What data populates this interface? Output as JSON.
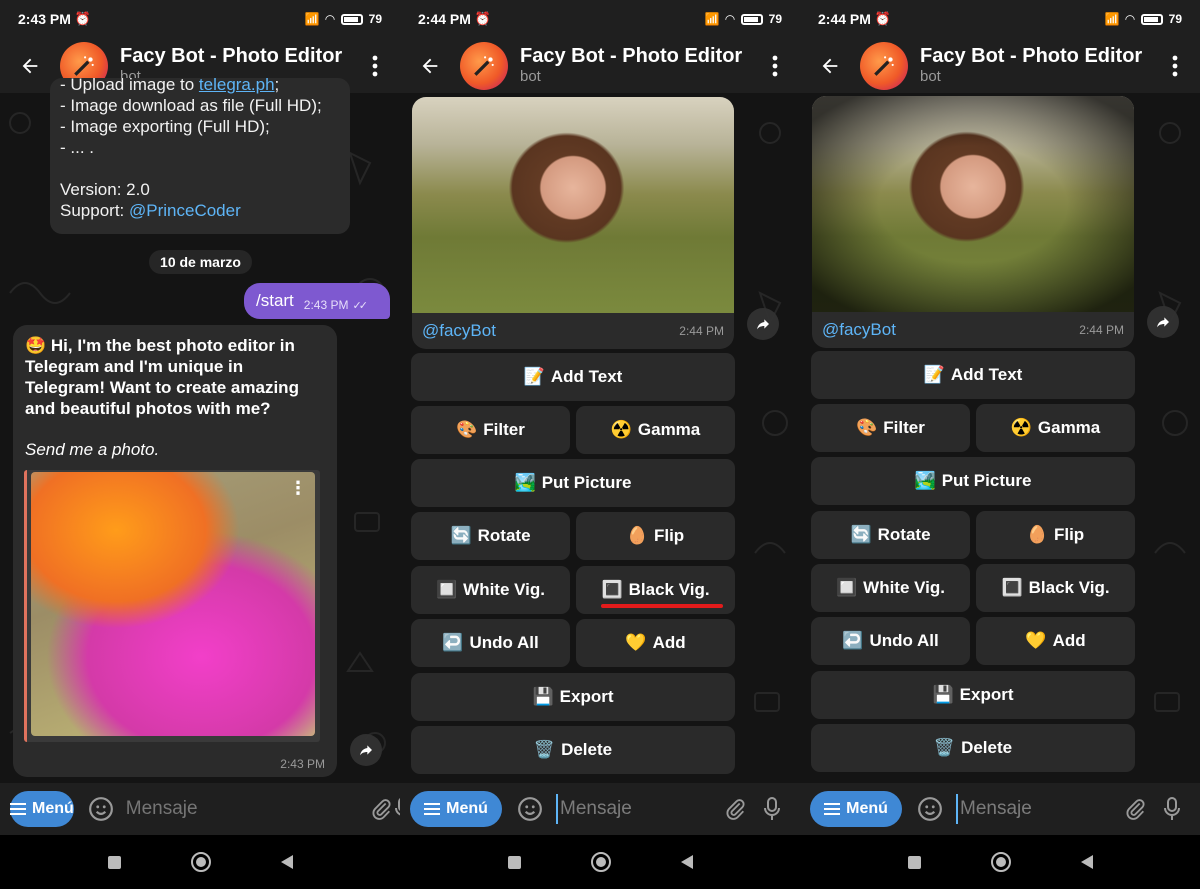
{
  "status_bar": [
    {
      "time": "2:43 PM",
      "battery": "79"
    },
    {
      "time": "2:44 PM",
      "battery": "79"
    },
    {
      "time": "2:44 PM",
      "battery": "79"
    }
  ],
  "chat": {
    "title": "Facy Bot - Photo Editor",
    "subtitle": "bot"
  },
  "screen1": {
    "info_lines": [
      "- Upload image to ",
      "- Image download as file (Full HD);",
      "- Image exporting (Full HD);",
      "- ... ."
    ],
    "info_link": "telegra.ph",
    "info_tail": ";",
    "version": "Version: 2.0",
    "support_label": "Support: ",
    "support_link": "@PrinceCoder",
    "date_chip": "10 de marzo",
    "out_message": "/start",
    "out_time": "2:43 PM",
    "bot_message": "Hi, I'm the best photo editor in Telegram and I'm unique in Telegram! Want to create amazing and beautiful photos with me?",
    "bot_italic": "Send me a photo.",
    "bot_time": "2:43 PM"
  },
  "photo_caption": {
    "user": "@facyBot",
    "time": "2:44 PM"
  },
  "keyboard": {
    "add_text": "Add Text",
    "filter": "Filter",
    "gamma": "Gamma",
    "put_picture": "Put Picture",
    "rotate": "Rotate",
    "flip": "Flip",
    "white_vig": "White Vig.",
    "black_vig": "Black Vig.",
    "undo_all": "Undo All",
    "add": "Add",
    "export": "Export",
    "delete": "Delete"
  },
  "input": {
    "menu_label": "Menú",
    "placeholder": "Mensaje"
  },
  "colors": {
    "accent": "#3f88d5",
    "outgoing": "#7e59d0",
    "highlight": "#e31b1b",
    "link": "#5eb5f7"
  },
  "icons": [
    "back-arrow-icon",
    "more-vert-icon",
    "share-icon",
    "emoji-icon",
    "attach-icon",
    "mic-icon",
    "hamburger-icon"
  ]
}
